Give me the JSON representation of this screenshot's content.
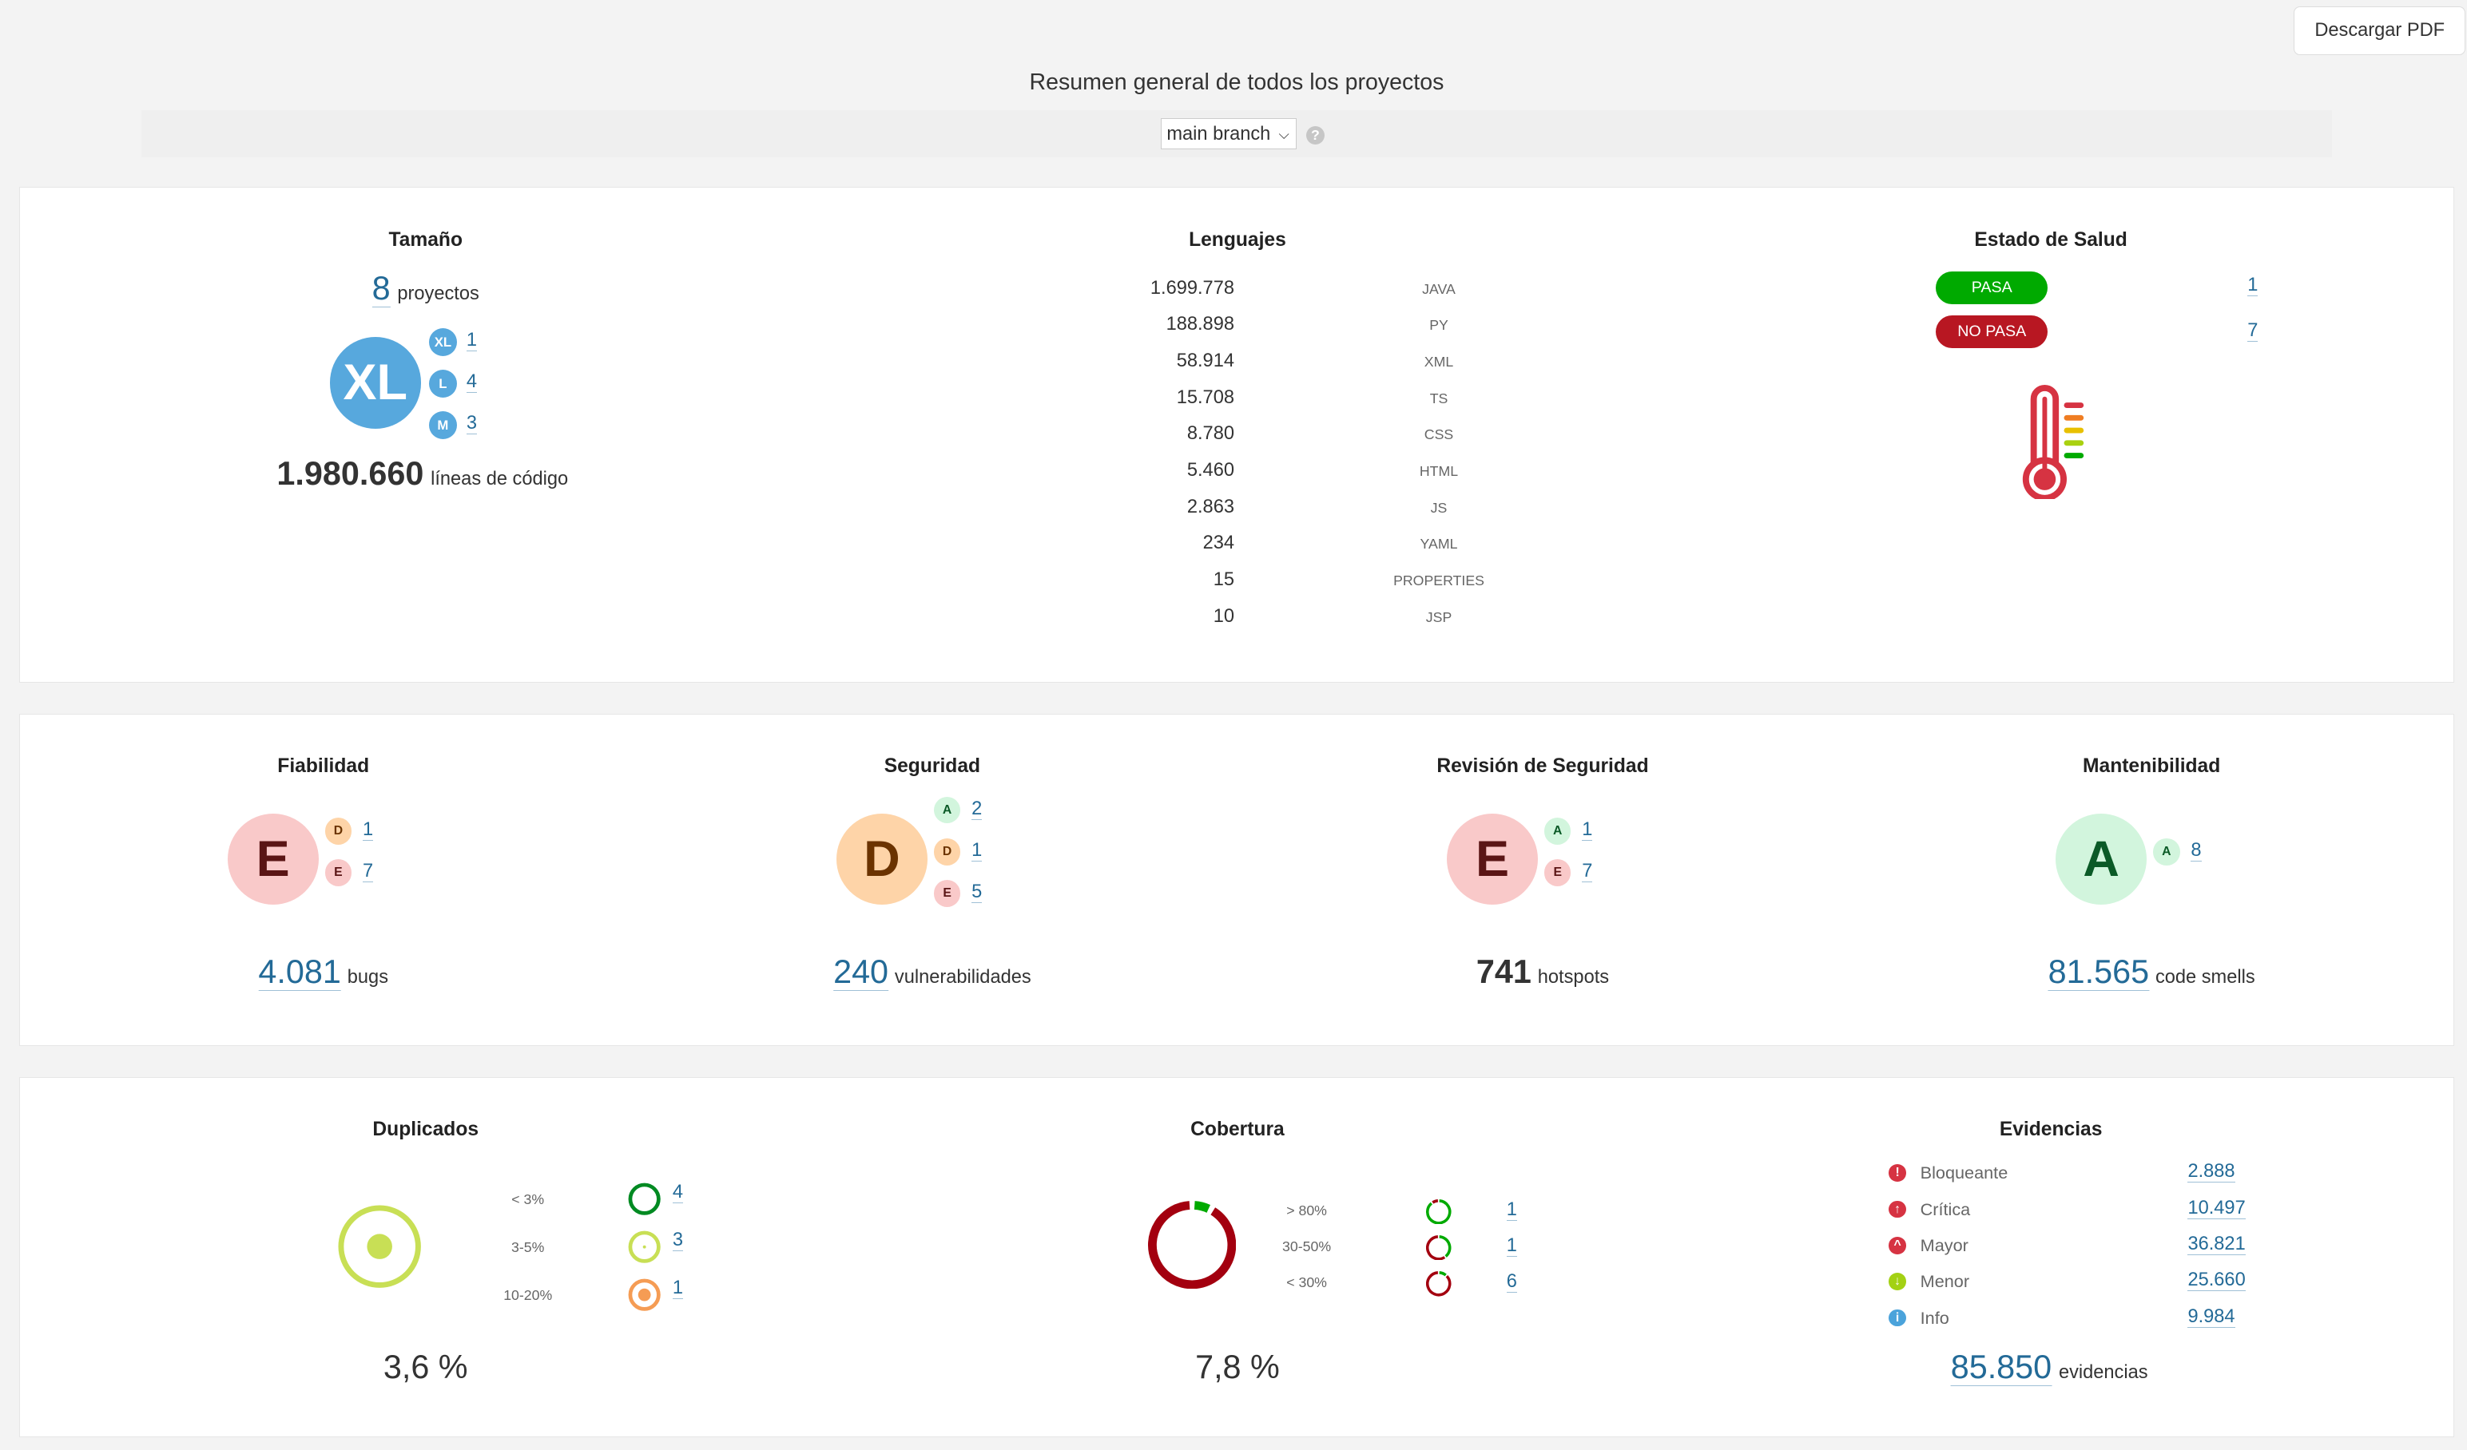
{
  "header": {
    "download_pdf": "Descargar PDF",
    "title": "Resumen general de todos los proyectos",
    "branch": "main branch",
    "help": "?"
  },
  "size": {
    "title": "Tamaño",
    "projects": "8",
    "projects_label": "proyectos",
    "main_badge": "XL",
    "breakdown": [
      {
        "badge": "XL",
        "count": "1"
      },
      {
        "badge": "L",
        "count": "4"
      },
      {
        "badge": "M",
        "count": "3"
      }
    ],
    "lines": "1.980.660",
    "lines_label": "líneas de código"
  },
  "languages": {
    "title": "Lenguajes",
    "items": [
      {
        "lines": "1.699.778",
        "lang": "JAVA"
      },
      {
        "lines": "188.898",
        "lang": "PY"
      },
      {
        "lines": "58.914",
        "lang": "XML"
      },
      {
        "lines": "15.708",
        "lang": "TS"
      },
      {
        "lines": "8.780",
        "lang": "CSS"
      },
      {
        "lines": "5.460",
        "lang": "HTML"
      },
      {
        "lines": "2.863",
        "lang": "JS"
      },
      {
        "lines": "234",
        "lang": "YAML"
      },
      {
        "lines": "15",
        "lang": "PROPERTIES"
      },
      {
        "lines": "10",
        "lang": "JSP"
      }
    ]
  },
  "health": {
    "title": "Estado de Salud",
    "pass": "PASA",
    "pass_count": "1",
    "fail": "NO PASA",
    "fail_count": "7",
    "pass_color": "#00aa00",
    "fail_color": "#b81722",
    "icon": "thermometer-icon"
  },
  "ratings": [
    {
      "title": "Fiabilidad",
      "grade": "E",
      "breakdown": [
        {
          "g": "D",
          "n": "1"
        },
        {
          "g": "E",
          "n": "7"
        }
      ],
      "value": "4.081",
      "unit": "bugs",
      "link": true
    },
    {
      "title": "Seguridad",
      "grade": "D",
      "breakdown": [
        {
          "g": "A",
          "n": "2"
        },
        {
          "g": "D",
          "n": "1"
        },
        {
          "g": "E",
          "n": "5"
        }
      ],
      "value": "240",
      "unit": "vulnerabilidades",
      "link": true
    },
    {
      "title": "Revisión de Seguridad",
      "grade": "E",
      "breakdown": [
        {
          "g": "A",
          "n": "1"
        },
        {
          "g": "E",
          "n": "7"
        }
      ],
      "value": "741",
      "unit": "hotspots",
      "link": false
    },
    {
      "title": "Mantenibilidad",
      "grade": "A",
      "breakdown": [
        {
          "g": "A",
          "n": "8"
        }
      ],
      "value": "81.565",
      "unit": "code smells",
      "link": true
    }
  ],
  "grade_colors": {
    "A": {
      "bg": "#d2f5dd",
      "fg": "#0b5a27"
    },
    "D": {
      "bg": "#fed4a8",
      "fg": "#6b3300"
    },
    "E": {
      "bg": "#f9c9c9",
      "fg": "#5a1515"
    }
  },
  "duplications": {
    "title": "Duplicados",
    "value": "3,6 %",
    "buckets": [
      {
        "label": "< 3%",
        "count": "4",
        "color": "#008a22"
      },
      {
        "label": "3-5%",
        "count": "3",
        "color": "#c8df55"
      },
      {
        "label": "10-20%",
        "count": "1",
        "color": "#f59c54"
      }
    ]
  },
  "coverage": {
    "title": "Cobertura",
    "value": "7,8 %",
    "percent": 7.8,
    "buckets": [
      {
        "label": "> 80%",
        "count": "1",
        "percent": 90
      },
      {
        "label": "30-50%",
        "count": "1",
        "percent": 40
      },
      {
        "label": "< 30%",
        "count": "6",
        "percent": 12
      }
    ],
    "good_color": "#00aa00",
    "bad_color": "#a3000f"
  },
  "issues": {
    "title": "Evidencias",
    "items": [
      {
        "label": "Bloqueante",
        "count": "2.888",
        "color": "#d63342",
        "icon": "blocker-icon",
        "glyph": "!"
      },
      {
        "label": "Crítica",
        "count": "10.497",
        "color": "#d63342",
        "icon": "critical-icon",
        "glyph": "↑"
      },
      {
        "label": "Mayor",
        "count": "36.821",
        "color": "#d63342",
        "icon": "major-icon",
        "glyph": "^"
      },
      {
        "label": "Menor",
        "count": "25.660",
        "color": "#a3d114",
        "icon": "minor-icon",
        "glyph": "↓"
      },
      {
        "label": "Info",
        "count": "9.984",
        "color": "#4ba3db",
        "icon": "info-icon",
        "glyph": "i"
      }
    ],
    "total": "85.850",
    "total_label": "evidencias"
  }
}
